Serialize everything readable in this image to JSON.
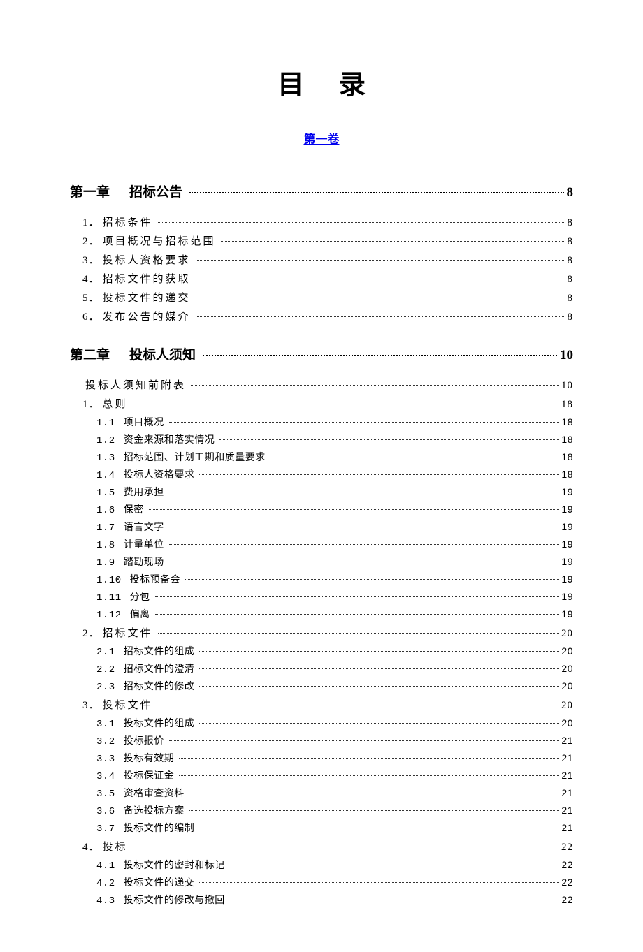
{
  "title": "目录",
  "subtitle": "第一卷",
  "chapters": [
    {
      "num": "第一章",
      "title": "招标公告",
      "page": "8",
      "items": [
        {
          "num": "1．",
          "title": "招标条件",
          "page": "8"
        },
        {
          "num": "2．",
          "title": "项目概况与招标范围",
          "page": "8"
        },
        {
          "num": "3．",
          "title": "投标人资格要求",
          "page": "8"
        },
        {
          "num": "4．",
          "title": "招标文件的获取",
          "page": "8"
        },
        {
          "num": "5．",
          "title": "投标文件的递交",
          "page": "8"
        },
        {
          "num": "6．",
          "title": "发布公告的媒介",
          "page": "8"
        }
      ]
    },
    {
      "num": "第二章",
      "title": "投标人须知",
      "page": "10",
      "items": [
        {
          "num": "",
          "title": "投标人须知前附表",
          "page": "10"
        },
        {
          "num": "1．",
          "title": "总则",
          "page": "18",
          "sub": [
            {
              "num": "1.1",
              "title": "项目概况",
              "page": "18"
            },
            {
              "num": "1.2",
              "title": "资金来源和落实情况",
              "page": "18"
            },
            {
              "num": "1.3",
              "title": "招标范围、计划工期和质量要求",
              "page": "18"
            },
            {
              "num": "1.4",
              "title": "投标人资格要求",
              "page": "18"
            },
            {
              "num": "1.5",
              "title": "费用承担",
              "page": "19"
            },
            {
              "num": "1.6",
              "title": "保密",
              "page": "19"
            },
            {
              "num": "1.7",
              "title": "语言文字",
              "page": "19"
            },
            {
              "num": "1.8",
              "title": "计量单位",
              "page": "19"
            },
            {
              "num": "1.9",
              "title": "踏勘现场",
              "page": "19"
            },
            {
              "num": "1.10",
              "title": "投标预备会",
              "page": "19"
            },
            {
              "num": "1.11",
              "title": "分包",
              "page": "19"
            },
            {
              "num": "1.12",
              "title": "偏离",
              "page": "19"
            }
          ]
        },
        {
          "num": "2．",
          "title": "招标文件",
          "page": "20",
          "sub": [
            {
              "num": "2.1",
              "title": "招标文件的组成",
              "page": "20"
            },
            {
              "num": "2.2",
              "title": "招标文件的澄清",
              "page": "20"
            },
            {
              "num": "2.3",
              "title": "招标文件的修改",
              "page": "20"
            }
          ]
        },
        {
          "num": "3．",
          "title": "投标文件",
          "page": "20",
          "sub": [
            {
              "num": "3.1",
              "title": "投标文件的组成",
              "page": "20"
            },
            {
              "num": "3.2",
              "title": "投标报价",
              "page": "21"
            },
            {
              "num": "3.3",
              "title": "投标有效期",
              "page": "21"
            },
            {
              "num": "3.4",
              "title": "投标保证金",
              "page": "21"
            },
            {
              "num": "3.5",
              "title": "资格审查资料",
              "page": "21"
            },
            {
              "num": "3.6",
              "title": "备选投标方案",
              "page": "21"
            },
            {
              "num": "3.7",
              "title": "投标文件的编制",
              "page": "21"
            }
          ]
        },
        {
          "num": "4．",
          "title": "投标",
          "page": "22",
          "sub": [
            {
              "num": "4.1",
              "title": "投标文件的密封和标记",
              "page": "22"
            },
            {
              "num": "4.2",
              "title": "投标文件的递交",
              "page": "22"
            },
            {
              "num": "4.3",
              "title": "投标文件的修改与撤回",
              "page": "22"
            }
          ]
        }
      ]
    }
  ]
}
